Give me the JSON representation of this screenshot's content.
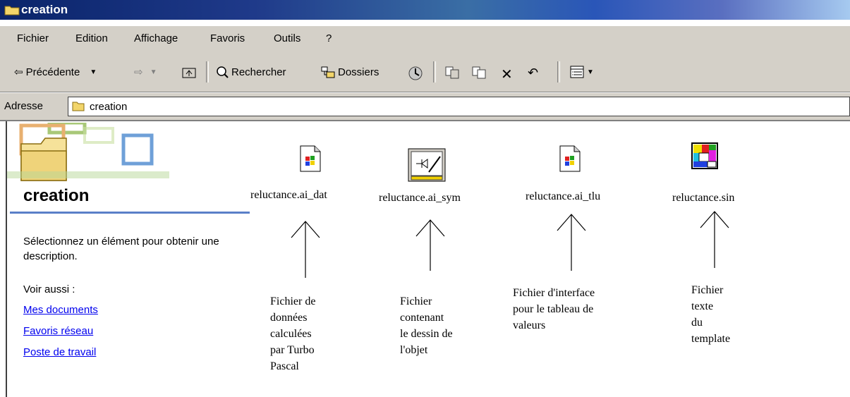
{
  "window": {
    "title": "creation"
  },
  "menu": [
    "Fichier",
    "Edition",
    "Affichage",
    "Favoris",
    "Outils",
    "?"
  ],
  "toolbar": {
    "back_label": "Précédente",
    "search_label": "Rechercher",
    "folders_label": "Dossiers"
  },
  "address": {
    "label": "Adresse",
    "value": "creation"
  },
  "sidebar": {
    "title": "creation",
    "description": "Sélectionnez un élément pour obtenir une description.",
    "see_also": "Voir aussi :",
    "links": [
      "Mes documents",
      "Favoris réseau",
      "Poste de travail"
    ]
  },
  "files": [
    {
      "name": "reluctance.ai_dat",
      "icon": "windows-file-icon",
      "annotation": [
        "Fichier de",
        "données",
        "calculées",
        "par Turbo",
        "Pascal"
      ]
    },
    {
      "name": "reluctance.ai_sym",
      "icon": "drawing-file-icon",
      "annotation": [
        "Fichier",
        "contenant",
        "le dessin de",
        "l'objet"
      ]
    },
    {
      "name": "reluctance.ai_tlu",
      "icon": "windows-file-icon",
      "annotation": [
        "Fichier d'interface",
        "pour le tableau de",
        "valeurs"
      ]
    },
    {
      "name": "reluctance.sin",
      "icon": "template-file-icon",
      "annotation": [
        "Fichier",
        "texte",
        "du",
        "template"
      ]
    }
  ],
  "colors": {
    "title_bar": "#0a246a",
    "chrome": "#d4d0c8",
    "link": "#0000ee",
    "sidebar_rule": "#5a7fc8"
  }
}
